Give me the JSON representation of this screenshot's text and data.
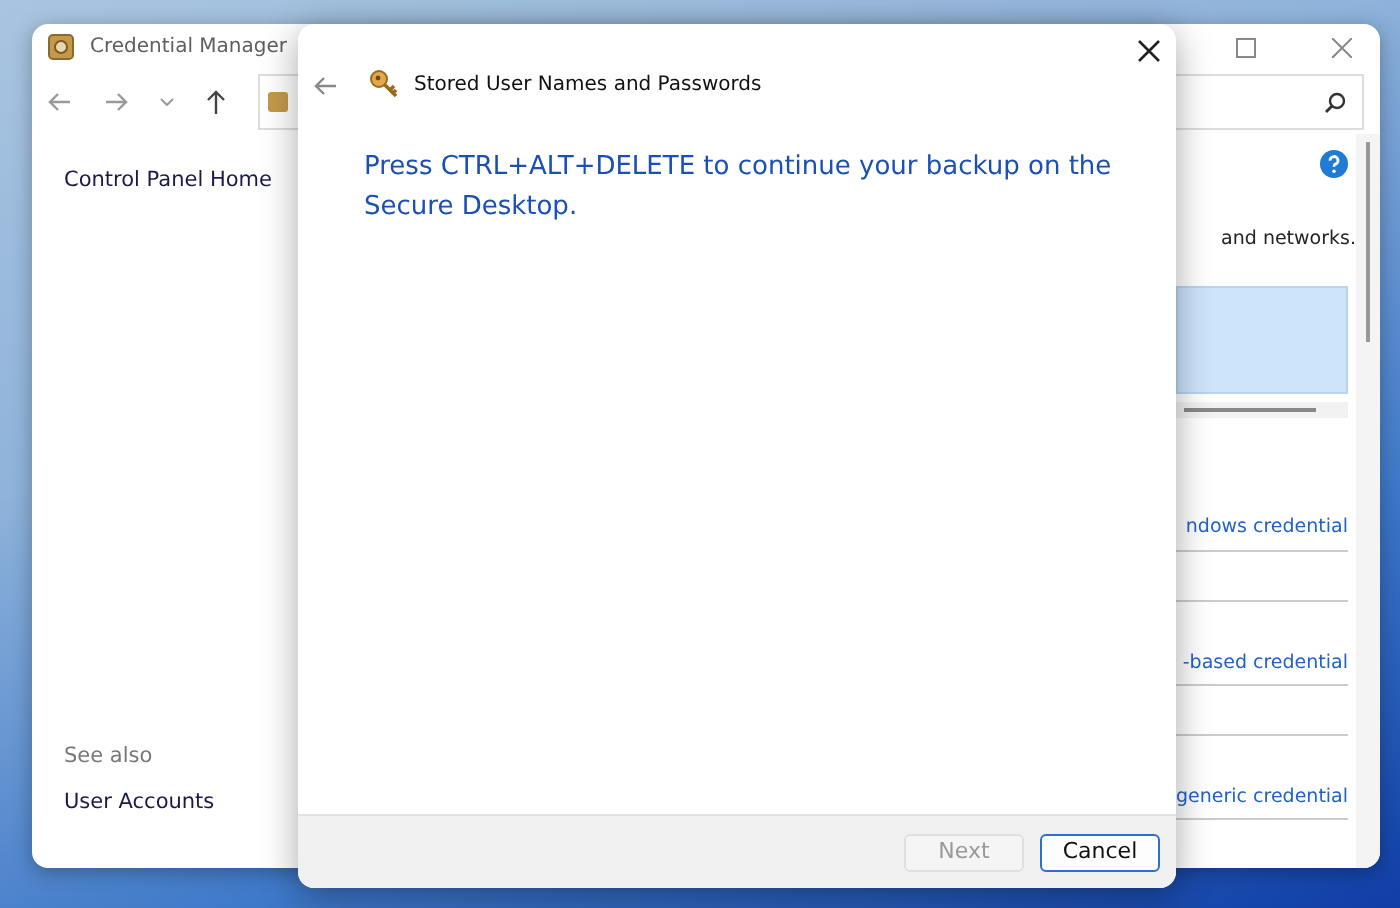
{
  "background_window": {
    "title": "Credential Manager",
    "sidebar": {
      "items": [
        {
          "label": "Control Panel Home"
        }
      ],
      "see_also": {
        "heading": "See also",
        "items": [
          "User Accounts"
        ]
      }
    },
    "content": {
      "description": "and networks.",
      "links": [
        "ndows credential",
        "-based credential",
        "generic credential"
      ]
    }
  },
  "dialog": {
    "title": "Stored User Names and Passwords",
    "message": "Press CTRL+ALT+DELETE to continue your backup on the Secure Desktop.",
    "buttons": [
      {
        "label": "Next",
        "disabled": true,
        "focused": false
      },
      {
        "label": "Cancel",
        "disabled": false,
        "focused": true
      }
    ]
  }
}
